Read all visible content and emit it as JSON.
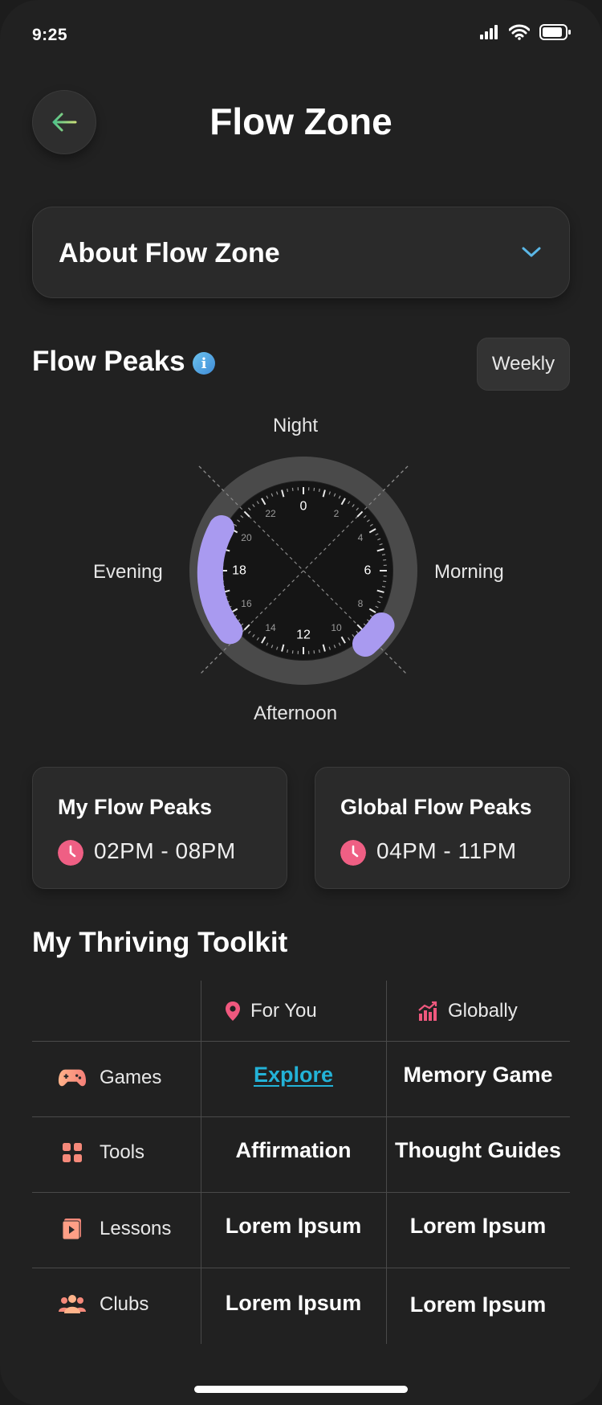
{
  "status_bar": {
    "time": "9:25"
  },
  "header": {
    "title": "Flow Zone"
  },
  "accordion": {
    "label": "About Flow Zone"
  },
  "flow_peaks": {
    "title": "Flow Peaks",
    "info_glyph": "i",
    "period_button": "Weekly",
    "dial": {
      "labels": {
        "top": "Night",
        "left": "Evening",
        "right": "Morning",
        "bottom": "Afternoon"
      },
      "hour_numbers": [
        "0",
        "2",
        "4",
        "6",
        "8",
        "10",
        "12",
        "14",
        "16",
        "18",
        "20",
        "22"
      ],
      "accent_color": "#a99af0"
    }
  },
  "peak_cards": [
    {
      "title": "My Flow Peaks",
      "range": "02PM - 08PM"
    },
    {
      "title": "Global Flow Peaks",
      "range": "04PM - 11PM"
    }
  ],
  "toolkit": {
    "title": "My Thriving Toolkit",
    "columns": [
      {
        "label": "For You",
        "icon": "location-pin-icon"
      },
      {
        "label": "Globally",
        "icon": "trending-chart-icon"
      }
    ],
    "rows": [
      {
        "label": "Games",
        "icon": "gamepad-icon",
        "for_you": "Explore",
        "globally": "Memory Game"
      },
      {
        "label": "Tools",
        "icon": "grid-icon",
        "for_you": "Affirmation",
        "globally": "Thought Guides"
      },
      {
        "label": "Lessons",
        "icon": "video-book-icon",
        "for_you": "Lorem Ipsum",
        "globally": "Lorem Ipsum"
      },
      {
        "label": "Clubs",
        "icon": "group-icon",
        "for_you": "Lorem Ipsum",
        "globally": "Lorem Ipsum"
      }
    ]
  },
  "colors": {
    "background": "#212121",
    "link": "#23b2d7",
    "accent_pink": "#f0587e",
    "accent_purple": "#a99af0"
  }
}
